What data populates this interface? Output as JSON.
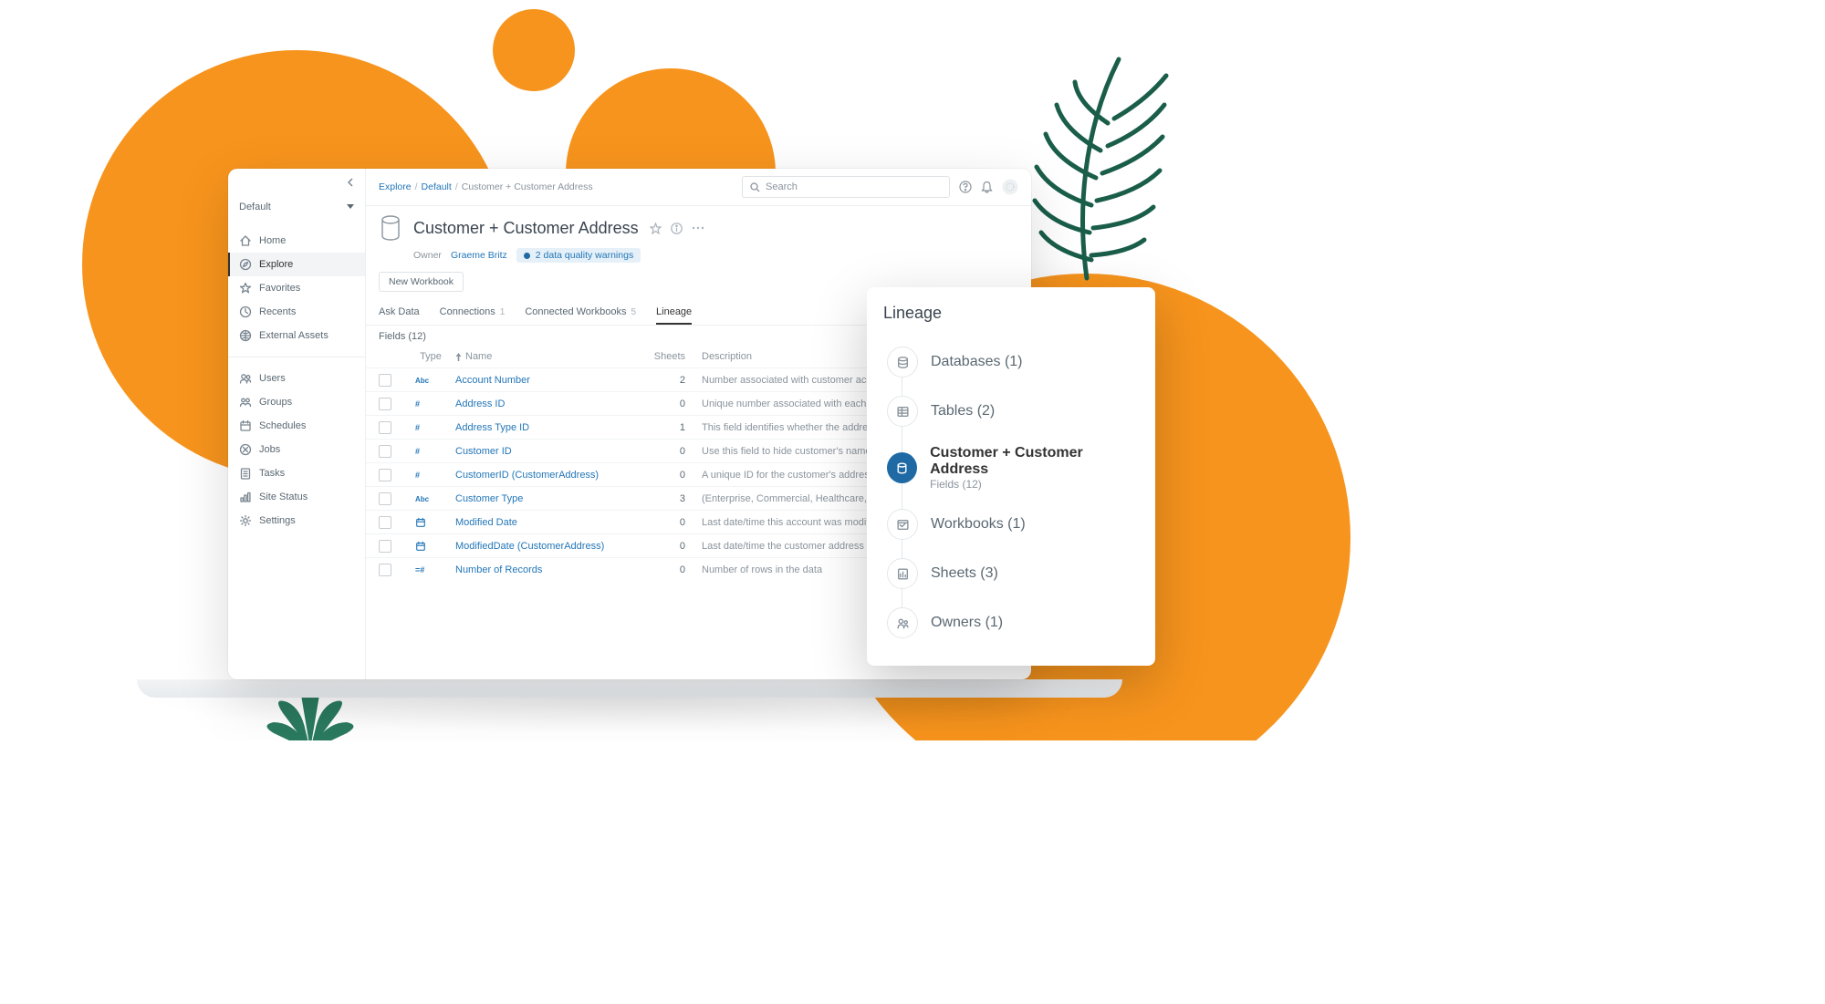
{
  "sidebar": {
    "project": "Default",
    "nav1": [
      {
        "icon": "home",
        "label": "Home"
      },
      {
        "icon": "compass",
        "label": "Explore",
        "active": true
      },
      {
        "icon": "star",
        "label": "Favorites"
      },
      {
        "icon": "clock",
        "label": "Recents"
      },
      {
        "icon": "external",
        "label": "External Assets"
      }
    ],
    "nav2": [
      {
        "icon": "users",
        "label": "Users"
      },
      {
        "icon": "groups",
        "label": "Groups"
      },
      {
        "icon": "calendar",
        "label": "Schedules"
      },
      {
        "icon": "jobs",
        "label": "Jobs"
      },
      {
        "icon": "tasks",
        "label": "Tasks"
      },
      {
        "icon": "status",
        "label": "Site Status"
      },
      {
        "icon": "gear",
        "label": "Settings"
      }
    ]
  },
  "breadcrumb": {
    "root": "Explore",
    "mid": "Default",
    "current": "Customer + Customer Address"
  },
  "search_placeholder": "Search",
  "header": {
    "title": "Customer + Customer Address",
    "owner_label": "Owner",
    "owner_name": "Graeme Britz",
    "dq_warning": "2 data quality warnings",
    "new_workbook": "New Workbook"
  },
  "tabs": [
    {
      "label": "Ask Data"
    },
    {
      "label": "Connections",
      "count": "1"
    },
    {
      "label": "Connected Workbooks",
      "count": "5"
    },
    {
      "label": "Lineage",
      "active": true
    }
  ],
  "fields_header": "Fields (12)",
  "columns": {
    "type": "Type",
    "name": "Name",
    "sheets": "Sheets",
    "desc": "Description"
  },
  "rows": [
    {
      "type": "Abc",
      "name": "Account Number",
      "sheets": "2",
      "desc": "Number associated with customer account"
    },
    {
      "type": "#",
      "name": "Address ID",
      "sheets": "0",
      "desc": "Unique number associated with each customer's address"
    },
    {
      "type": "#",
      "name": "Address Type ID",
      "sheets": "1",
      "desc": "This field identifies whether the address is a residence, commercial or c"
    },
    {
      "type": "#",
      "name": "Customer ID",
      "sheets": "0",
      "desc": "Use this field to hide customer's name"
    },
    {
      "type": "#",
      "name": "CustomerID (CustomerAddress)",
      "sheets": "0",
      "desc": "A unique ID for the customer's address"
    },
    {
      "type": "Abc",
      "name": "Customer Type",
      "sheets": "3",
      "desc": "(Enterprise, Commercial, Healthcare, etc)"
    },
    {
      "type": "date",
      "name": "Modified Date",
      "sheets": "0",
      "desc": "Last date/time this account was modified"
    },
    {
      "type": "date",
      "name": "ModifiedDate (CustomerAddress)",
      "sheets": "0",
      "desc": "Last date/time the customer address was modified"
    },
    {
      "type": "=#",
      "name": "Number of Records",
      "sheets": "0",
      "desc": "Number of rows in the data"
    }
  ],
  "lineage": {
    "title": "Lineage",
    "items": [
      {
        "icon": "db",
        "label": "Databases (1)"
      },
      {
        "icon": "table",
        "label": "Tables (2)"
      },
      {
        "icon": "ds",
        "label": "Customer + Customer Address",
        "sub": "Fields (12)",
        "active": true
      },
      {
        "icon": "wb",
        "label": "Workbooks (1)"
      },
      {
        "icon": "sheet",
        "label": "Sheets (3)"
      },
      {
        "icon": "owner",
        "label": "Owners (1)"
      }
    ]
  }
}
